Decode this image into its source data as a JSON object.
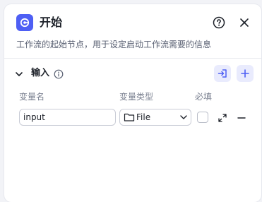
{
  "header": {
    "title": "开始",
    "description": "工作流的起始节点，用于设定启动工作流需要的信息"
  },
  "section": {
    "title": "输入"
  },
  "columns": {
    "name": "变量名",
    "type": "变量类型",
    "required": "必填"
  },
  "variables": [
    {
      "name": "input",
      "type": "File",
      "required": false
    }
  ],
  "icons": {
    "app": "start-node-icon",
    "help": "help-circle-icon",
    "close": "close-icon",
    "collapse": "chevron-down-icon",
    "info": "info-icon",
    "import": "import-icon",
    "add": "plus-icon",
    "folder": "folder-icon",
    "dropdown": "chevron-down-icon",
    "expand": "expand-arrows-icon",
    "remove": "minus-icon"
  },
  "colors": {
    "accent": "#4e5ff4",
    "accent_light": "#e9ebfd"
  }
}
